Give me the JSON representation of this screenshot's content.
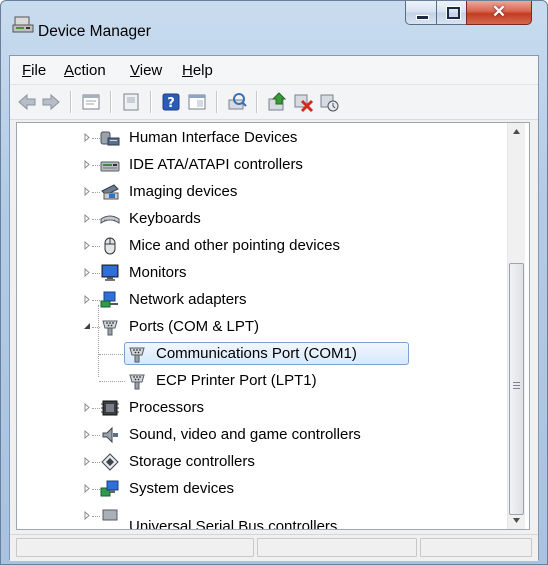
{
  "window": {
    "title": "Device Manager"
  },
  "menu": [
    {
      "label": "File",
      "accel": "F",
      "rest": "ile"
    },
    {
      "label": "Action",
      "accel": "A",
      "rest": "ction"
    },
    {
      "label": "View",
      "accel": "V",
      "rest": "iew"
    },
    {
      "label": "Help",
      "accel": "H",
      "rest": "elp"
    }
  ],
  "toolbar": {
    "buttons": [
      "back-icon",
      "forward-icon",
      "properties-icon",
      "update-icon",
      "help-icon",
      "show-hide-console-icon",
      "scan-hardware-icon",
      "update-driver-icon",
      "disable-device-icon",
      "uninstall-device-icon"
    ]
  },
  "tree": {
    "items": [
      {
        "label": "Human Interface Devices",
        "icon": "hid-icon"
      },
      {
        "label": "IDE ATA/ATAPI controllers",
        "icon": "ide-controller-icon"
      },
      {
        "label": "Imaging devices",
        "icon": "imaging-device-icon"
      },
      {
        "label": "Keyboards",
        "icon": "keyboard-icon"
      },
      {
        "label": "Mice and other pointing devices",
        "icon": "mouse-icon"
      },
      {
        "label": "Monitors",
        "icon": "monitor-icon"
      },
      {
        "label": "Network adapters",
        "icon": "network-adapter-icon"
      },
      {
        "label": "Ports (COM & LPT)",
        "icon": "port-icon",
        "expanded": true
      },
      {
        "label": "Communications Port (COM1)",
        "icon": "port-icon",
        "child": true,
        "selected": true
      },
      {
        "label": "ECP Printer Port (LPT1)",
        "icon": "port-icon",
        "child": true
      },
      {
        "label": "Processors",
        "icon": "processor-icon"
      },
      {
        "label": "Sound, video and game controllers",
        "icon": "sound-icon"
      },
      {
        "label": "Storage controllers",
        "icon": "storage-icon"
      },
      {
        "label": "System devices",
        "icon": "system-device-icon"
      },
      {
        "label": "Universal Serial Bus controllers",
        "icon": "usb-icon",
        "partial": true
      }
    ]
  },
  "colors": {
    "selection_border": "#7da2ce",
    "selection_fill": "#d8e8fb",
    "close_button": "#c43b22"
  }
}
